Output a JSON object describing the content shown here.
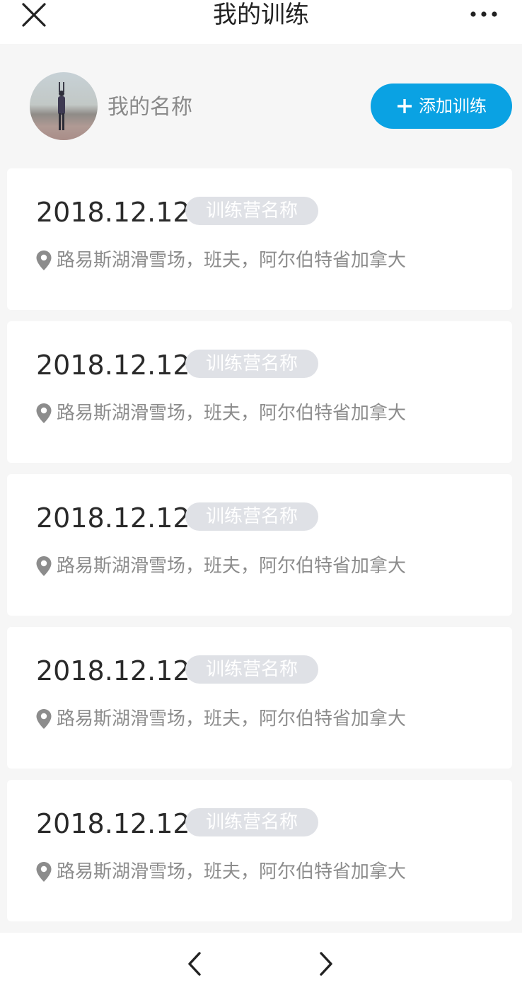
{
  "nav": {
    "title": "我的训练",
    "close_icon": "close-icon",
    "more_icon": "more-dots-icon"
  },
  "profile": {
    "name": "我的名称",
    "add_button_label": "添加训练",
    "add_icon": "plus-icon"
  },
  "colors": {
    "accent": "#0aa2e3",
    "badge_bg": "#dfe1e6",
    "background": "#f6f6f6"
  },
  "trainings": [
    {
      "date": "2018.12.12",
      "camp": "训练营名称",
      "location": "路易斯湖滑雪场，班夫，阿尔伯特省加拿大"
    },
    {
      "date": "2018.12.12",
      "camp": "训练营名称",
      "location": "路易斯湖滑雪场，班夫，阿尔伯特省加拿大"
    },
    {
      "date": "2018.12.12",
      "camp": "训练营名称",
      "location": "路易斯湖滑雪场，班夫，阿尔伯特省加拿大"
    },
    {
      "date": "2018.12.12",
      "camp": "训练营名称",
      "location": "路易斯湖滑雪场，班夫，阿尔伯特省加拿大"
    },
    {
      "date": "2018.12.12",
      "camp": "训练营名称",
      "location": "路易斯湖滑雪场，班夫，阿尔伯特省加拿大"
    }
  ],
  "pagination": {
    "prev_icon": "chevron-left-icon",
    "next_icon": "chevron-right-icon"
  }
}
